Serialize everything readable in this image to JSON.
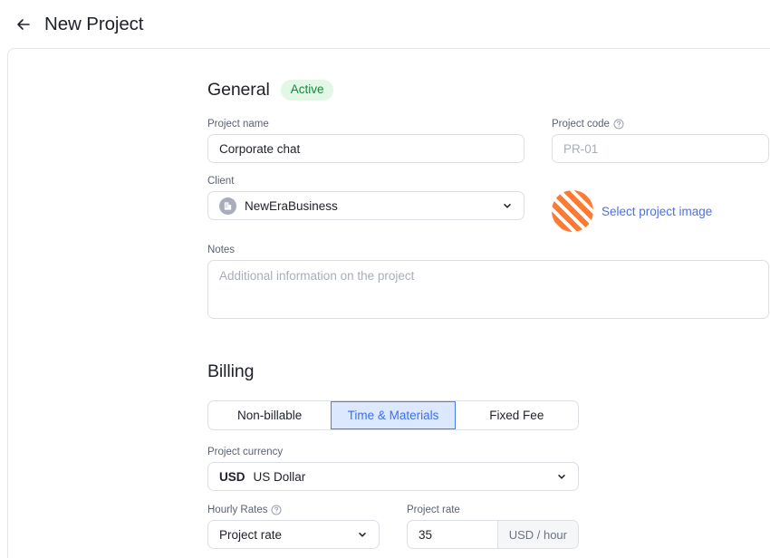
{
  "header": {
    "back_icon": "arrow-left-icon",
    "title": "New Project"
  },
  "general": {
    "title": "General",
    "status_badge": "Active",
    "project_name": {
      "label": "Project name",
      "value": "Corporate chat"
    },
    "project_code": {
      "label": "Project code",
      "help_icon": "help-circle-icon",
      "placeholder": "PR-01",
      "value": ""
    },
    "client": {
      "label": "Client",
      "value": "NewEraBusiness",
      "avatar_icon": "building-icon",
      "chevron_icon": "chevron-down-icon"
    },
    "project_image": {
      "link_label": "Select project image",
      "thumb_icon": "striped-circle-icon"
    },
    "notes": {
      "label": "Notes",
      "placeholder": "Additional information on the project",
      "value": ""
    }
  },
  "billing": {
    "title": "Billing",
    "billing_types": [
      {
        "label": "Non-billable",
        "selected": false
      },
      {
        "label": "Time & Materials",
        "selected": true
      },
      {
        "label": "Fixed Fee",
        "selected": false
      }
    ],
    "currency": {
      "label": "Project currency",
      "code": "USD",
      "name": "US Dollar",
      "chevron_icon": "chevron-down-icon"
    },
    "hourly_rates": {
      "label": "Hourly Rates",
      "help_icon": "help-circle-icon",
      "value": "Project rate",
      "chevron_icon": "chevron-down-icon"
    },
    "project_rate": {
      "label": "Project rate",
      "value": "35",
      "suffix": "USD / hour"
    }
  },
  "colors": {
    "accent_blue": "#4a7df5",
    "link_blue": "#4a6fe8",
    "badge_bg": "#e2f7e6",
    "badge_text": "#138a3a",
    "orange": "#fb7a34",
    "border": "#dcdfe4"
  }
}
